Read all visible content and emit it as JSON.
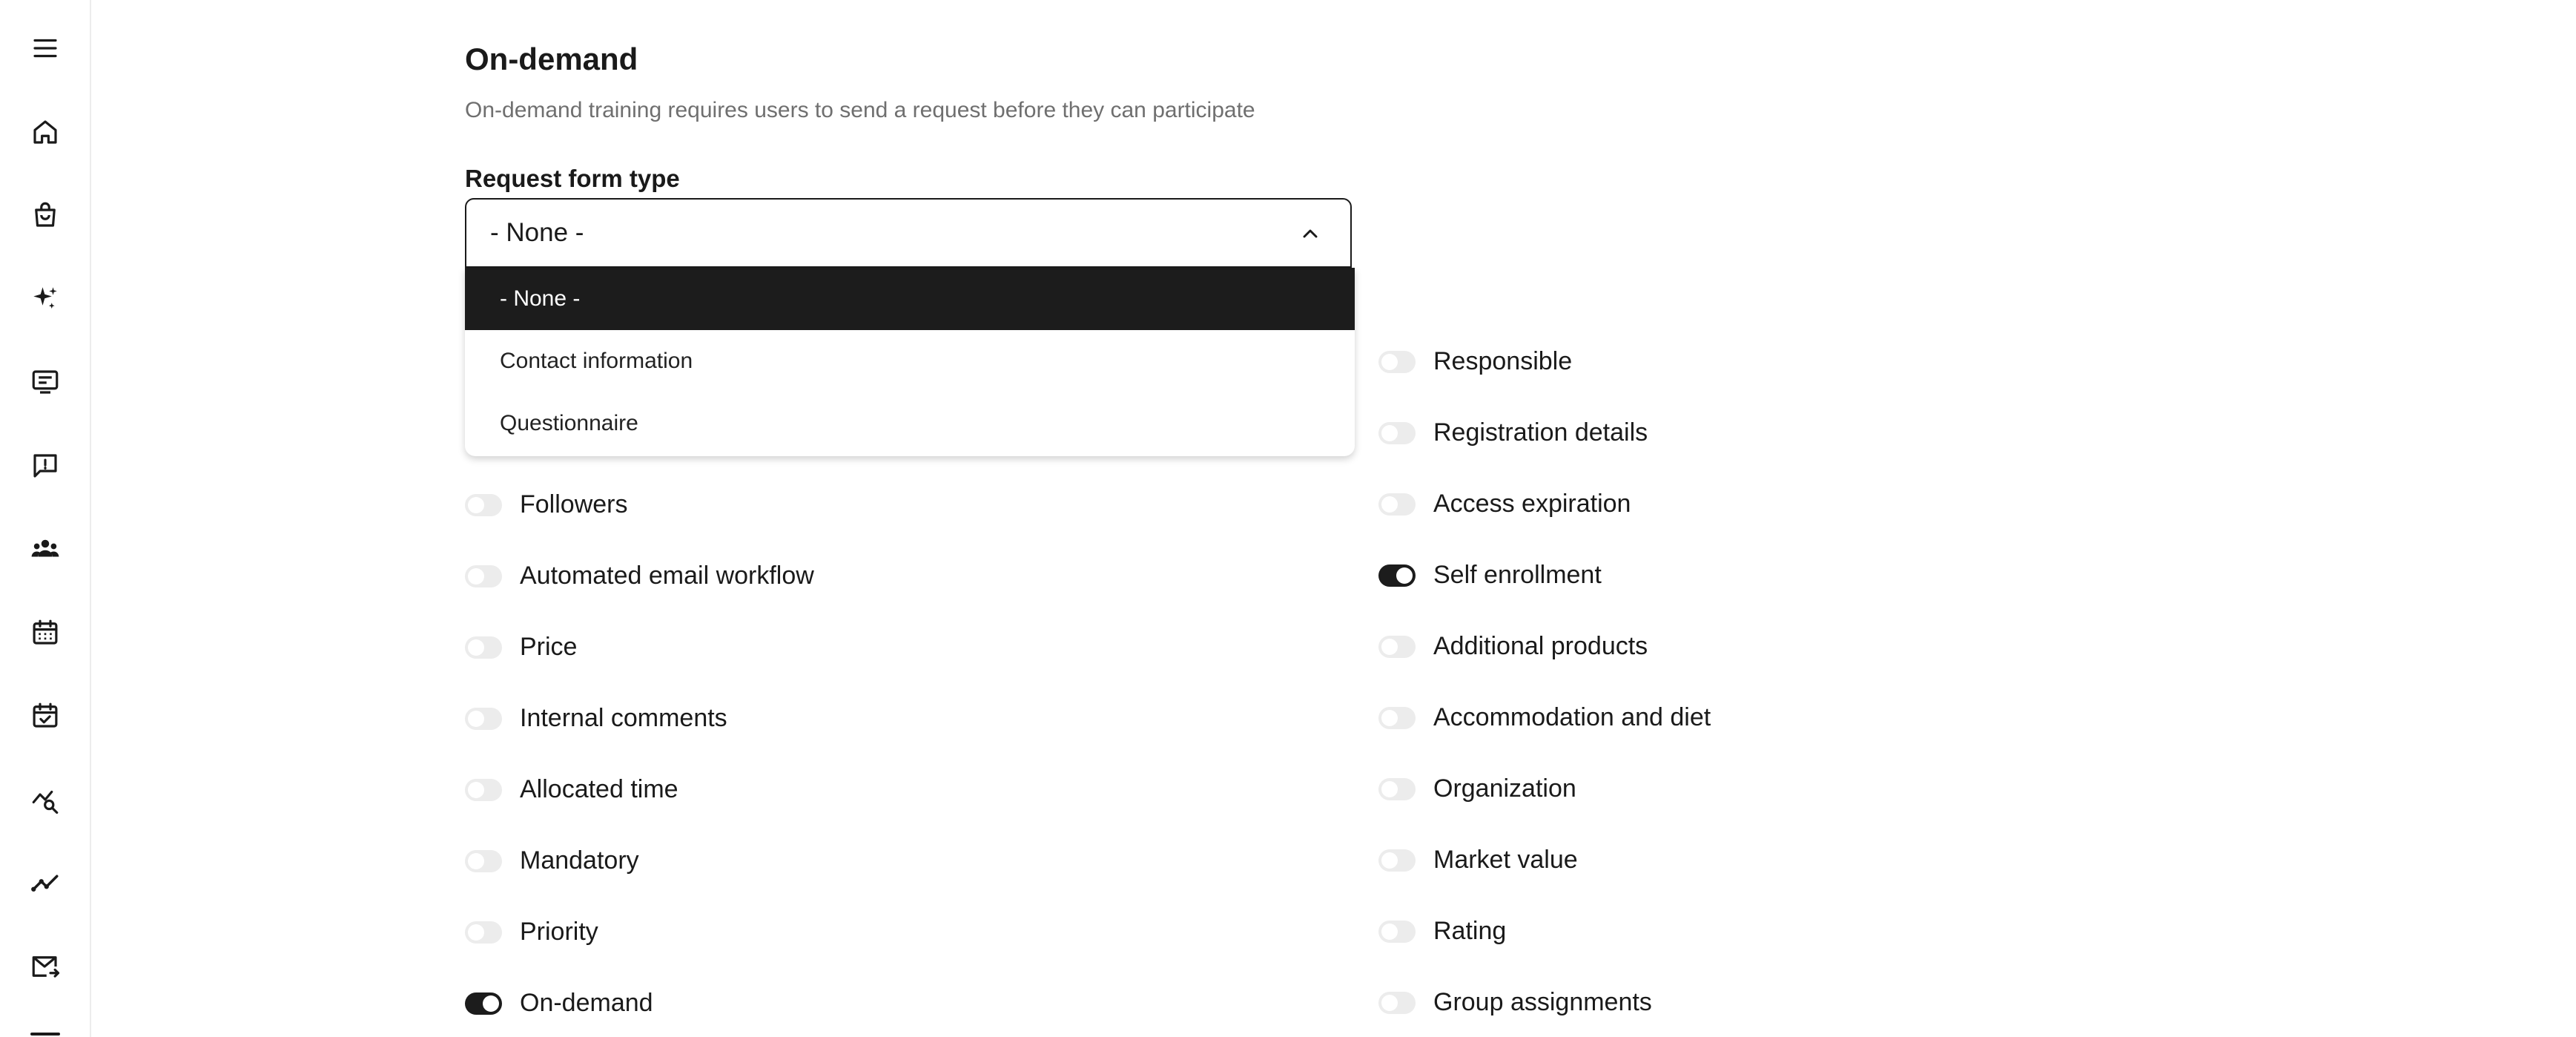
{
  "sidebar": {
    "items": [
      {
        "icon": "menu-icon"
      },
      {
        "icon": "home-icon"
      },
      {
        "icon": "shopping-bag-icon"
      },
      {
        "icon": "sparkles-icon"
      },
      {
        "icon": "presentation-icon"
      },
      {
        "icon": "feedback-alert-icon"
      },
      {
        "icon": "users-group-icon"
      },
      {
        "icon": "calendar-icon"
      },
      {
        "icon": "calendar-check-icon"
      },
      {
        "icon": "analytics-search-icon"
      },
      {
        "icon": "trending-up-icon"
      },
      {
        "icon": "mail-forward-icon"
      }
    ]
  },
  "section": {
    "title": "On-demand",
    "description": "On-demand training requires users to send a request before they can participate"
  },
  "request_form": {
    "label": "Request form type",
    "selected": "- None -",
    "options": [
      "- None -",
      "Contact information",
      "Questionnaire"
    ]
  },
  "toggles": {
    "left": [
      {
        "label": "Followers",
        "on": false
      },
      {
        "label": "Automated email workflow",
        "on": false
      },
      {
        "label": "Price",
        "on": false
      },
      {
        "label": "Internal comments",
        "on": false
      },
      {
        "label": "Allocated time",
        "on": false
      },
      {
        "label": "Mandatory",
        "on": false
      },
      {
        "label": "Priority",
        "on": false
      },
      {
        "label": "On-demand",
        "on": true
      }
    ],
    "right": [
      {
        "label": "Responsible",
        "on": false
      },
      {
        "label": "Registration details",
        "on": false
      },
      {
        "label": "Access expiration",
        "on": false
      },
      {
        "label": "Self enrollment",
        "on": true
      },
      {
        "label": "Additional products",
        "on": false
      },
      {
        "label": "Accommodation and diet",
        "on": false
      },
      {
        "label": "Organization",
        "on": false
      },
      {
        "label": "Market value",
        "on": false
      },
      {
        "label": "Rating",
        "on": false
      },
      {
        "label": "Group assignments",
        "on": false
      }
    ]
  },
  "colors": {
    "accent": "#1c1c1c",
    "toggle_off": "#ececec",
    "muted_text": "#6f6f6f"
  }
}
